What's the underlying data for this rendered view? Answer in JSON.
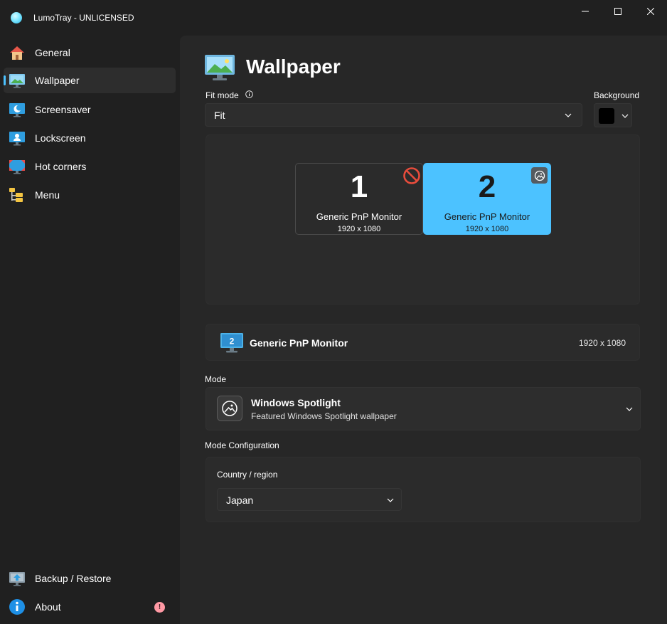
{
  "app": {
    "title": "LumoTray - UNLICENSED"
  },
  "window_controls": {
    "minimize": "minimize-icon",
    "maximize": "maximize-icon",
    "close": "close-icon"
  },
  "sidebar": {
    "items": [
      {
        "label": "General",
        "icon": "home-icon",
        "active": false
      },
      {
        "label": "Wallpaper",
        "icon": "wallpaper-icon",
        "active": true
      },
      {
        "label": "Screensaver",
        "icon": "screensaver-icon",
        "active": false
      },
      {
        "label": "Lockscreen",
        "icon": "lockscreen-icon",
        "active": false
      },
      {
        "label": "Hot corners",
        "icon": "hot-corners-icon",
        "active": false
      },
      {
        "label": "Menu",
        "icon": "menu-icon",
        "active": false
      }
    ],
    "footer_items": [
      {
        "label": "Backup / Restore",
        "icon": "backup-icon"
      },
      {
        "label": "About",
        "icon": "info-icon",
        "badge": "!"
      }
    ]
  },
  "page": {
    "title": "Wallpaper",
    "fit_mode": {
      "label": "Fit mode",
      "value": "Fit"
    },
    "background": {
      "label": "Background",
      "color": "#000000"
    },
    "monitors": [
      {
        "number": "1",
        "name": "Generic PnP Monitor",
        "resolution": "1920 x 1080",
        "selected": false,
        "status_icon": "disabled-icon"
      },
      {
        "number": "2",
        "name": "Generic PnP Monitor",
        "resolution": "1920 x 1080",
        "selected": true,
        "status_icon": "spotlight-icon"
      }
    ],
    "selected_monitor": {
      "number": "2",
      "name": "Generic PnP Monitor",
      "resolution": "1920 x 1080"
    },
    "mode": {
      "label": "Mode",
      "title": "Windows Spotlight",
      "description": "Featured Windows Spotlight wallpaper"
    },
    "mode_configuration": {
      "label": "Mode Configuration",
      "country_label": "Country / region",
      "country_value": "Japan"
    }
  },
  "colors": {
    "accent": "#4cc2ff",
    "background": "#202020",
    "content": "#272727",
    "card": "#2b2b2b",
    "error": "#e74c3c"
  }
}
